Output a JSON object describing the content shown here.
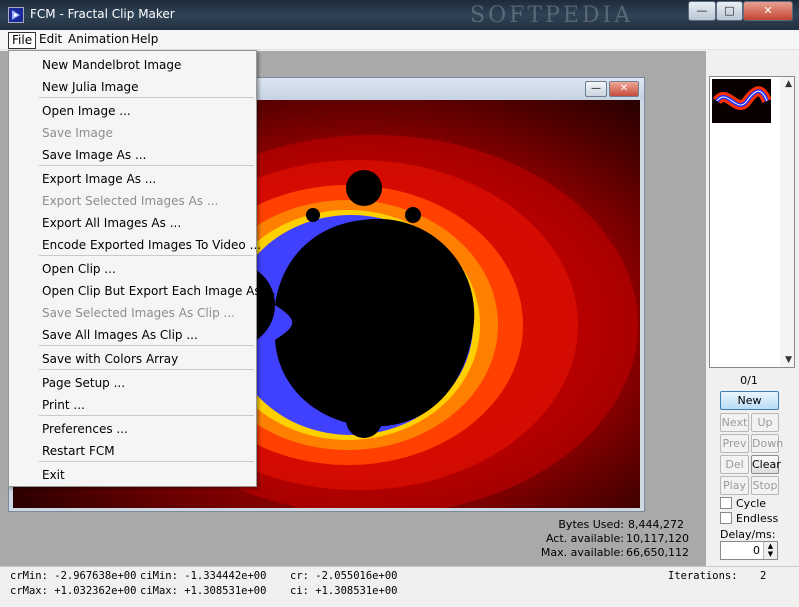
{
  "window": {
    "title": "FCM - Fractal Clip Maker",
    "watermark": "SOFTPEDIA",
    "min": "—",
    "max": "□",
    "close": "✕"
  },
  "menubar": {
    "file": "File",
    "edit": "Edit",
    "animation": "Animation",
    "help": "Help"
  },
  "file_menu": {
    "new_mandelbrot": "New Mandelbrot Image",
    "new_julia": "New Julia Image",
    "open_image": "Open Image ...",
    "save_image": "Save Image",
    "save_image_as": "Save Image As ...",
    "export_image_as": "Export Image As ...",
    "export_selected": "Export Selected Images As ...",
    "export_all": "Export All Images As ...",
    "encode_video": "Encode Exported Images To Video ...",
    "open_clip": "Open Clip ...",
    "open_clip_export": "Open Clip But Export Each Image As ...",
    "save_selected_clip": "Save Selected Images As Clip ...",
    "save_all_clip": "Save All Images As Clip  ...",
    "save_colors": "Save with Colors Array",
    "page_setup": "Page Setup ...",
    "print": "Print ...",
    "preferences": "Preferences ...",
    "restart": "Restart FCM",
    "exit": "Exit"
  },
  "child_window": {
    "min": "—",
    "close": "✕"
  },
  "panel": {
    "counter": "0/1",
    "new": "New",
    "next": "Next",
    "up": "Up",
    "prev": "Prev",
    "down": "Down",
    "del": "Del",
    "clear": "Clear",
    "play": "Play",
    "stop": "Stop",
    "cycle": "Cycle",
    "endless": "Endless",
    "delay_label": "Delay/ms:",
    "delay_value": "0"
  },
  "memory": {
    "bytes_used_label": "Bytes Used:",
    "bytes_used": "8,444,272",
    "act_label": "Act. available:",
    "act": "10,117,120",
    "max_label": "Max. available:",
    "max": "66,650,112"
  },
  "status": {
    "crmin": "crMin: -2.967638e+00",
    "cimin": "ciMin: -1.334442e+00",
    "cr": "cr: -2.055016e+00",
    "crmax": "crMax: +1.032362e+00",
    "cimax": "ciMax: +1.308531e+00",
    "ci": "ci: +1.308531e+00",
    "iterations_label": "Iterations:",
    "iterations": "2"
  },
  "colors": {
    "accent": "#3c7fb1",
    "fractal_black": "#000000",
    "fractal_red": "#cc0000",
    "fractal_yellow": "#ffee00"
  }
}
